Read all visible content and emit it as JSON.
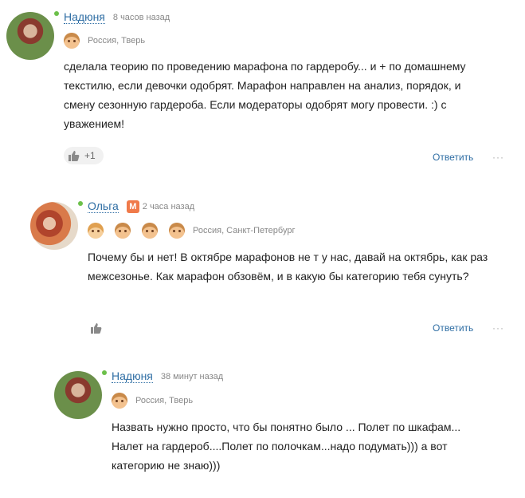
{
  "comments": [
    {
      "author": "Надюня",
      "time": "8 часов назад",
      "location": "Россия, Тверь",
      "text": "сделала теорию по проведению марафона по гардеробу... и + по домашнему текстилю, если девочки одобрят. Марафон направлен на анализ, порядок, и смену сезонную гардероба. Если модераторы одобрят могу провести. :) с уважением!",
      "likes": "+1",
      "reply_label": "Ответить",
      "more_label": "···"
    },
    {
      "author": "Ольга",
      "badge": "М",
      "time": "2 часа назад",
      "location": "Россия, Санкт-Петербург",
      "text": "Почему бы и нет! В октябре марафонов не т у нас, давай на октябрь, как раз межсезонье. Как марафон обзовём, и в какую бы категорию тебя сунуть?",
      "reply_label": "Ответить",
      "more_label": "···"
    },
    {
      "author": "Надюня",
      "time": "38 минут назад",
      "location": "Россия, Тверь",
      "text": "Назвать нужно просто, что бы понятно было ... Полет по шкафам... Налет на гардероб....Полет по полочкам...надо подумать))) а вот категорию не знаю)))"
    }
  ],
  "colors": {
    "link": "#2f6ea4",
    "online": "#6cc04a",
    "moderator": "#f07a4a"
  }
}
